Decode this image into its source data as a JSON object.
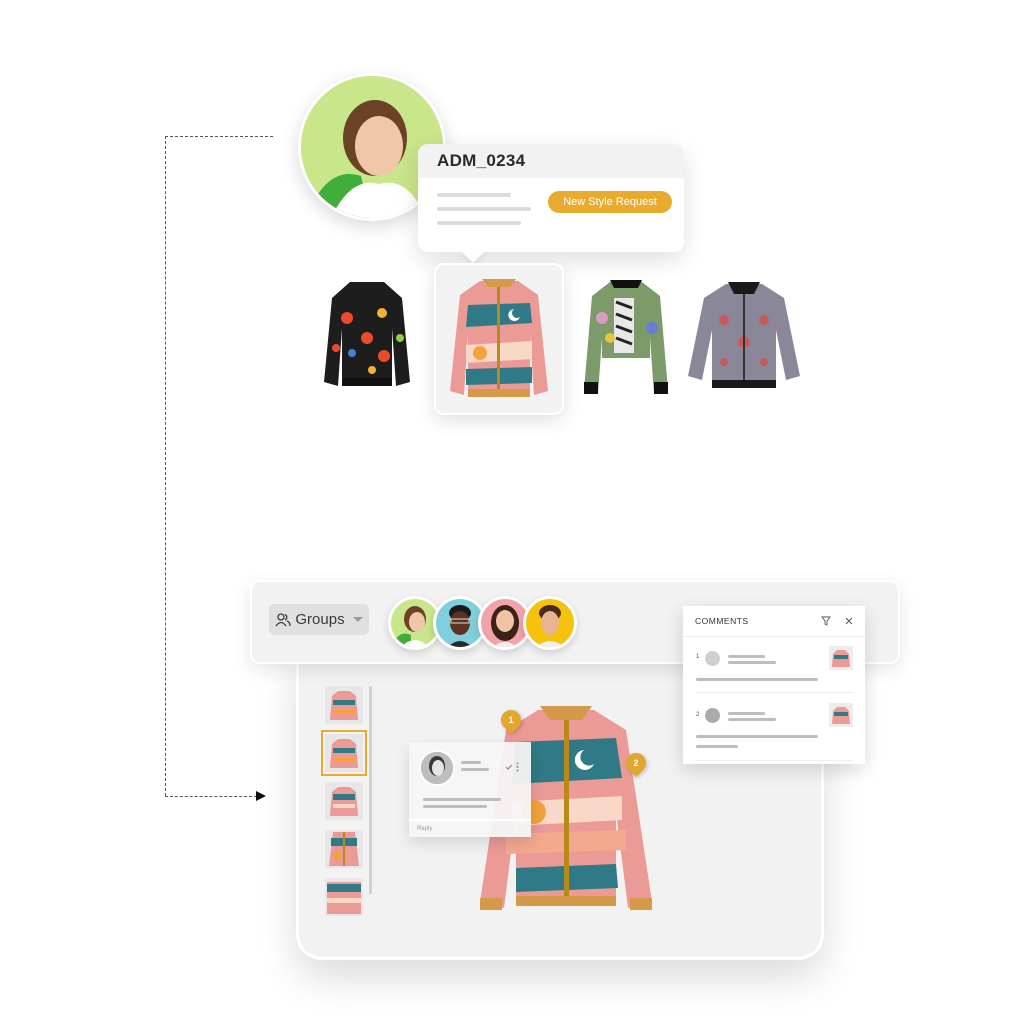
{
  "request_card": {
    "id": "ADM_0234",
    "badge": "New Style Request",
    "badge_color": "#e8ab2e"
  },
  "jackets": [
    {
      "name": "floral-black-bomber",
      "selected": false
    },
    {
      "name": "moon-landscape-bomber",
      "selected": true
    },
    {
      "name": "tropical-cropped-bomber",
      "selected": false
    },
    {
      "name": "damask-grey-bomber",
      "selected": false
    }
  ],
  "toolbar": {
    "groups_label": "Groups",
    "groups_icon": "users-icon",
    "members": [
      "member-1",
      "member-2",
      "member-3",
      "member-4"
    ]
  },
  "comments_panel": {
    "title": "COMMENTS",
    "filter_icon": "filter-icon",
    "close_icon": "close-icon",
    "items": [
      {
        "number": "1"
      },
      {
        "number": "2"
      }
    ]
  },
  "popover": {
    "reply_label": "Reply"
  },
  "pins": [
    {
      "label": "1"
    },
    {
      "label": "2"
    }
  ],
  "accent_color": "#e8ab2e"
}
